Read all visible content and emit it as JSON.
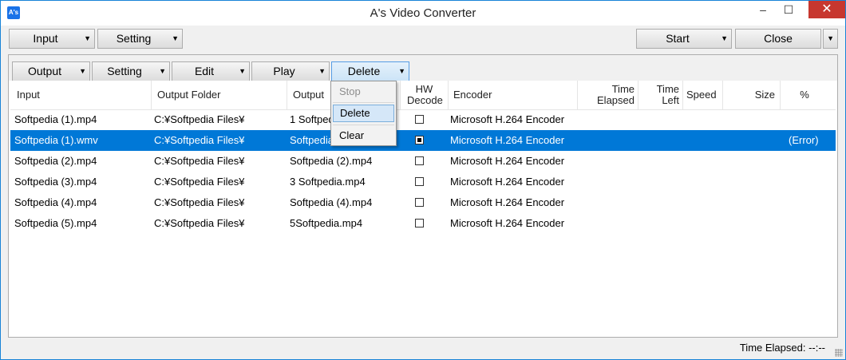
{
  "window": {
    "title": "A's Video Converter",
    "app_icon_text": "A's",
    "minimize": "–",
    "maximize": "☐",
    "close": "✕"
  },
  "toolbar_top": {
    "input_label": "Input",
    "setting_label": "Setting",
    "start_label": "Start",
    "close_label": "Close"
  },
  "toolbar_list": {
    "output_label": "Output",
    "setting_label": "Setting",
    "edit_label": "Edit",
    "play_label": "Play",
    "delete_label": "Delete"
  },
  "columns": {
    "input": "Input",
    "output_folder": "Output Folder",
    "output": "Output",
    "hw_decode": "HW Decode",
    "encoder": "Encoder",
    "time_elapsed": "Time Elapsed",
    "time_left": "Time Left",
    "speed": "Speed",
    "size": "Size",
    "percent": "%"
  },
  "rows": [
    {
      "input": "Softpedia (1).mp4",
      "folder": "C:¥Softpedia Files¥",
      "output": "1 Softpedia.mp4",
      "hw": false,
      "encoder": "Microsoft H.264 Encoder",
      "percent": ""
    },
    {
      "input": "Softpedia (1).wmv",
      "folder": "C:¥Softpedia Files¥",
      "output": "Softpedia (1).mp4",
      "hw": true,
      "encoder": "Microsoft H.264 Encoder",
      "percent": "(Error)"
    },
    {
      "input": "Softpedia (2).mp4",
      "folder": "C:¥Softpedia Files¥",
      "output": "Softpedia (2).mp4",
      "hw": false,
      "encoder": "Microsoft H.264 Encoder",
      "percent": ""
    },
    {
      "input": "Softpedia (3).mp4",
      "folder": "C:¥Softpedia Files¥",
      "output": "3 Softpedia.mp4",
      "hw": false,
      "encoder": "Microsoft H.264 Encoder",
      "percent": ""
    },
    {
      "input": "Softpedia (4).mp4",
      "folder": "C:¥Softpedia Files¥",
      "output": "Softpedia (4).mp4",
      "hw": false,
      "encoder": "Microsoft H.264 Encoder",
      "percent": ""
    },
    {
      "input": "Softpedia (5).mp4",
      "folder": "C:¥Softpedia Files¥",
      "output": "5Softpedia.mp4",
      "hw": false,
      "encoder": "Microsoft H.264 Encoder",
      "percent": ""
    }
  ],
  "selected_row": 1,
  "context_menu": {
    "stop": "Stop",
    "delete": "Delete",
    "clear": "Clear"
  },
  "status": {
    "time_elapsed": "Time Elapsed: --:--"
  },
  "colors": {
    "selection": "#0078d7",
    "close_button": "#c7372f",
    "accent_border": "#1883d7"
  },
  "icons": {
    "dropdown": "chevron-down-icon",
    "app": "app-icon"
  }
}
